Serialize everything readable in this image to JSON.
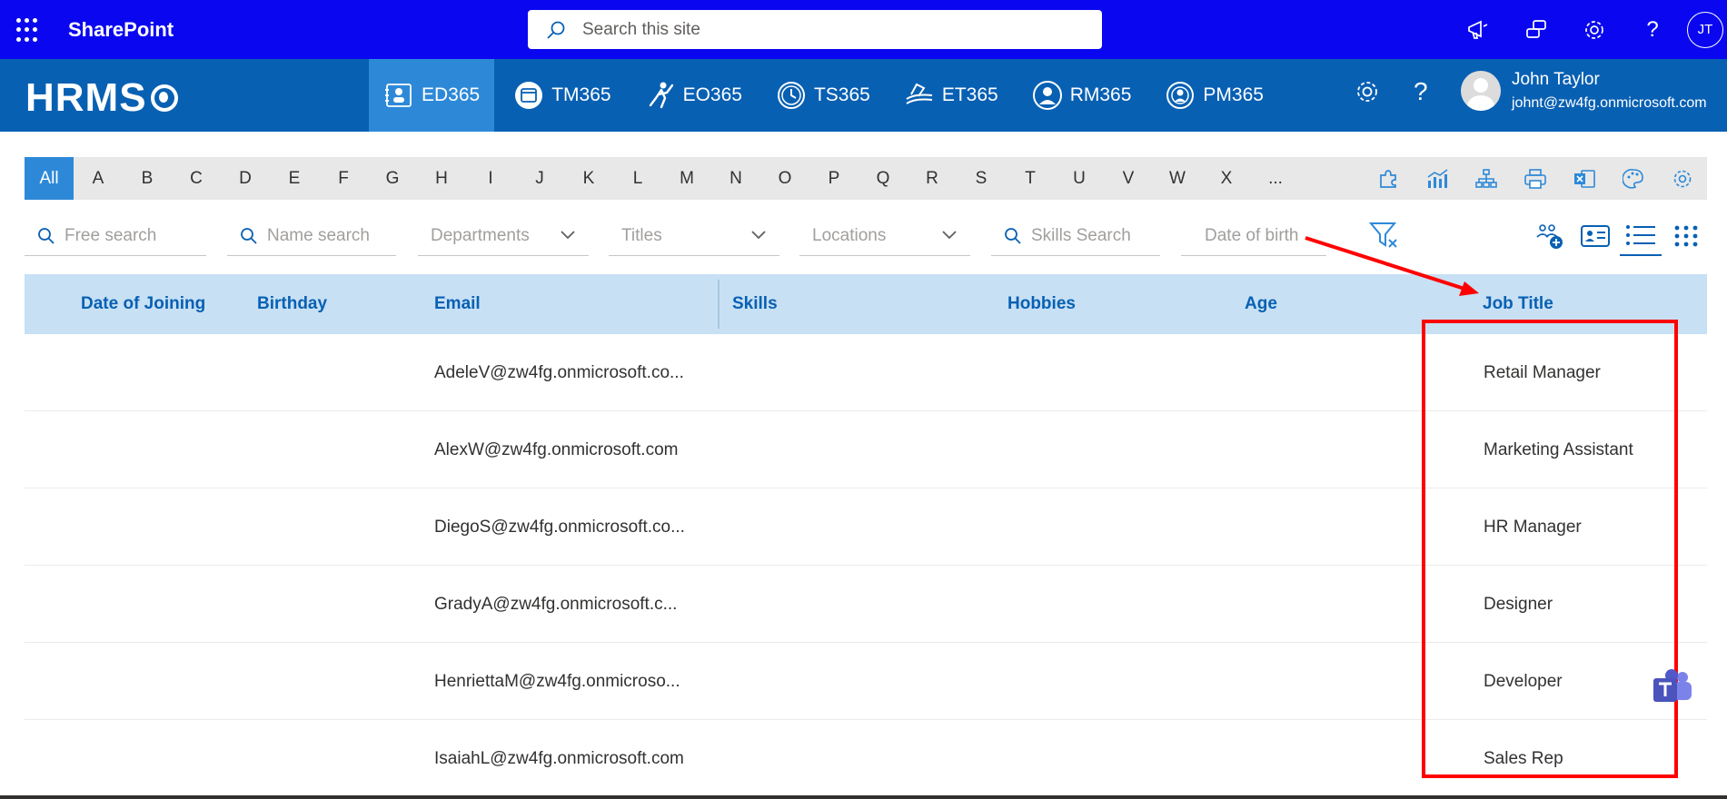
{
  "suitebar": {
    "title": "SharePoint",
    "search_placeholder": "Search this site",
    "icons": [
      "megaphone-icon",
      "chat-icon",
      "settings-icon",
      "help-icon"
    ],
    "user_initials": "JT"
  },
  "appbar": {
    "logo": "HRMS",
    "modules": [
      {
        "label": "ED365",
        "icon": "employee-directory-icon",
        "active": true
      },
      {
        "label": "TM365",
        "icon": "task-manager-icon",
        "active": false
      },
      {
        "label": "EO365",
        "icon": "onboarding-icon",
        "active": false
      },
      {
        "label": "TS365",
        "icon": "timesheet-icon",
        "active": false
      },
      {
        "label": "ET365",
        "icon": "expense-icon",
        "active": false
      },
      {
        "label": "RM365",
        "icon": "recruitment-icon",
        "active": false
      },
      {
        "label": "PM365",
        "icon": "performance-icon",
        "active": false
      }
    ],
    "user": {
      "name": "John Taylor",
      "email": "johnt@zw4fg.onmicrosoft.com"
    }
  },
  "alphabet": [
    "All",
    "A",
    "B",
    "C",
    "D",
    "E",
    "F",
    "G",
    "H",
    "I",
    "J",
    "K",
    "L",
    "M",
    "N",
    "O",
    "P",
    "Q",
    "R",
    "S",
    "T",
    "U",
    "V",
    "W",
    "X",
    "..."
  ],
  "filters": {
    "free_search": "Free search",
    "name_search": "Name search",
    "departments": "Departments",
    "titles": "Titles",
    "locations": "Locations",
    "skills_search": "Skills Search",
    "date_of_birth": "Date of birth"
  },
  "table": {
    "columns": [
      "Date of Joining",
      "Birthday",
      "Email",
      "Skills",
      "Hobbies",
      "Age",
      "Job Title"
    ],
    "rows": [
      {
        "email": "AdeleV@zw4fg.onmicrosoft.co...",
        "job_title": "Retail Manager"
      },
      {
        "email": "AlexW@zw4fg.onmicrosoft.com",
        "job_title": "Marketing Assistant"
      },
      {
        "email": "DiegoS@zw4fg.onmicrosoft.co...",
        "job_title": "HR Manager"
      },
      {
        "email": "GradyA@zw4fg.onmicrosoft.c...",
        "job_title": "Designer"
      },
      {
        "email": "HenriettaM@zw4fg.onmicroso...",
        "job_title": "Developer"
      },
      {
        "email": "IsaiahL@zw4fg.onmicrosoft.com",
        "job_title": "Sales Rep"
      }
    ]
  },
  "colors": {
    "suitebar": "#0a07f0",
    "appbar": "#0860b3",
    "accent": "#2d89d8",
    "table_header": "#c7e0f4",
    "annotation": "#ff0000"
  }
}
